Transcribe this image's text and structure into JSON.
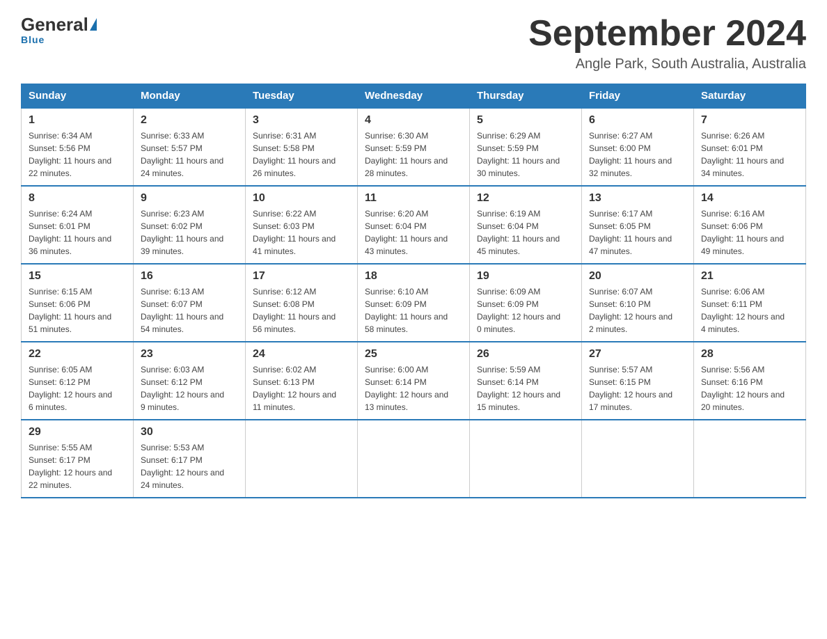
{
  "logo": {
    "general": "General",
    "blue": "Blue",
    "underline": "Blue"
  },
  "title": "September 2024",
  "subtitle": "Angle Park, South Australia, Australia",
  "days_of_week": [
    "Sunday",
    "Monday",
    "Tuesday",
    "Wednesday",
    "Thursday",
    "Friday",
    "Saturday"
  ],
  "weeks": [
    [
      {
        "day": "1",
        "sunrise": "6:34 AM",
        "sunset": "5:56 PM",
        "daylight": "11 hours and 22 minutes."
      },
      {
        "day": "2",
        "sunrise": "6:33 AM",
        "sunset": "5:57 PM",
        "daylight": "11 hours and 24 minutes."
      },
      {
        "day": "3",
        "sunrise": "6:31 AM",
        "sunset": "5:58 PM",
        "daylight": "11 hours and 26 minutes."
      },
      {
        "day": "4",
        "sunrise": "6:30 AM",
        "sunset": "5:59 PM",
        "daylight": "11 hours and 28 minutes."
      },
      {
        "day": "5",
        "sunrise": "6:29 AM",
        "sunset": "5:59 PM",
        "daylight": "11 hours and 30 minutes."
      },
      {
        "day": "6",
        "sunrise": "6:27 AM",
        "sunset": "6:00 PM",
        "daylight": "11 hours and 32 minutes."
      },
      {
        "day": "7",
        "sunrise": "6:26 AM",
        "sunset": "6:01 PM",
        "daylight": "11 hours and 34 minutes."
      }
    ],
    [
      {
        "day": "8",
        "sunrise": "6:24 AM",
        "sunset": "6:01 PM",
        "daylight": "11 hours and 36 minutes."
      },
      {
        "day": "9",
        "sunrise": "6:23 AM",
        "sunset": "6:02 PM",
        "daylight": "11 hours and 39 minutes."
      },
      {
        "day": "10",
        "sunrise": "6:22 AM",
        "sunset": "6:03 PM",
        "daylight": "11 hours and 41 minutes."
      },
      {
        "day": "11",
        "sunrise": "6:20 AM",
        "sunset": "6:04 PM",
        "daylight": "11 hours and 43 minutes."
      },
      {
        "day": "12",
        "sunrise": "6:19 AM",
        "sunset": "6:04 PM",
        "daylight": "11 hours and 45 minutes."
      },
      {
        "day": "13",
        "sunrise": "6:17 AM",
        "sunset": "6:05 PM",
        "daylight": "11 hours and 47 minutes."
      },
      {
        "day": "14",
        "sunrise": "6:16 AM",
        "sunset": "6:06 PM",
        "daylight": "11 hours and 49 minutes."
      }
    ],
    [
      {
        "day": "15",
        "sunrise": "6:15 AM",
        "sunset": "6:06 PM",
        "daylight": "11 hours and 51 minutes."
      },
      {
        "day": "16",
        "sunrise": "6:13 AM",
        "sunset": "6:07 PM",
        "daylight": "11 hours and 54 minutes."
      },
      {
        "day": "17",
        "sunrise": "6:12 AM",
        "sunset": "6:08 PM",
        "daylight": "11 hours and 56 minutes."
      },
      {
        "day": "18",
        "sunrise": "6:10 AM",
        "sunset": "6:09 PM",
        "daylight": "11 hours and 58 minutes."
      },
      {
        "day": "19",
        "sunrise": "6:09 AM",
        "sunset": "6:09 PM",
        "daylight": "12 hours and 0 minutes."
      },
      {
        "day": "20",
        "sunrise": "6:07 AM",
        "sunset": "6:10 PM",
        "daylight": "12 hours and 2 minutes."
      },
      {
        "day": "21",
        "sunrise": "6:06 AM",
        "sunset": "6:11 PM",
        "daylight": "12 hours and 4 minutes."
      }
    ],
    [
      {
        "day": "22",
        "sunrise": "6:05 AM",
        "sunset": "6:12 PM",
        "daylight": "12 hours and 6 minutes."
      },
      {
        "day": "23",
        "sunrise": "6:03 AM",
        "sunset": "6:12 PM",
        "daylight": "12 hours and 9 minutes."
      },
      {
        "day": "24",
        "sunrise": "6:02 AM",
        "sunset": "6:13 PM",
        "daylight": "12 hours and 11 minutes."
      },
      {
        "day": "25",
        "sunrise": "6:00 AM",
        "sunset": "6:14 PM",
        "daylight": "12 hours and 13 minutes."
      },
      {
        "day": "26",
        "sunrise": "5:59 AM",
        "sunset": "6:14 PM",
        "daylight": "12 hours and 15 minutes."
      },
      {
        "day": "27",
        "sunrise": "5:57 AM",
        "sunset": "6:15 PM",
        "daylight": "12 hours and 17 minutes."
      },
      {
        "day": "28",
        "sunrise": "5:56 AM",
        "sunset": "6:16 PM",
        "daylight": "12 hours and 20 minutes."
      }
    ],
    [
      {
        "day": "29",
        "sunrise": "5:55 AM",
        "sunset": "6:17 PM",
        "daylight": "12 hours and 22 minutes."
      },
      {
        "day": "30",
        "sunrise": "5:53 AM",
        "sunset": "6:17 PM",
        "daylight": "12 hours and 24 minutes."
      },
      null,
      null,
      null,
      null,
      null
    ]
  ],
  "labels": {
    "sunrise": "Sunrise:",
    "sunset": "Sunset:",
    "daylight": "Daylight:"
  }
}
